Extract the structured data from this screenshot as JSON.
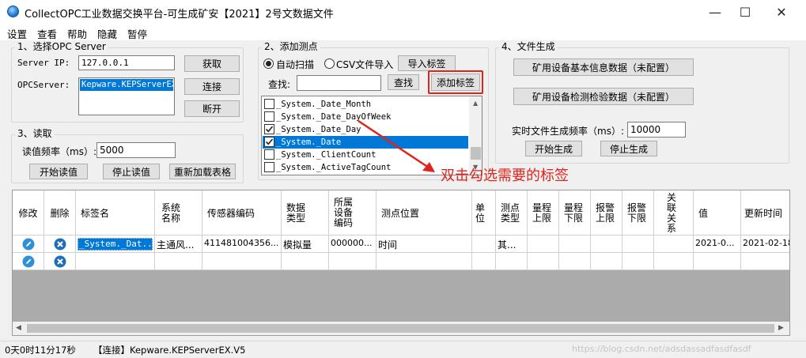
{
  "window": {
    "title": "CollectOPC工业数据交换平台-可生成矿安【2021】2号文数据文件",
    "controls": {
      "minimize": "—",
      "maximize": "☐",
      "close": "✕"
    }
  },
  "menu": {
    "items": [
      "设置",
      "查看",
      "帮助",
      "隐藏",
      "暂停"
    ]
  },
  "opc_select": {
    "title": "1、选择OPC Server",
    "server_ip_label": "Server IP:",
    "server_ip_value": "127.0.0.1",
    "opcserver_label": "OPCServer:",
    "opcserver_value": "Kepware.KEPServerEX",
    "fetch_button": "获取",
    "connect_button": "连接",
    "disconnect_button": "断开"
  },
  "read": {
    "title": "3、读取",
    "freq_label": "读值频率（ms）:",
    "freq_value": "5000",
    "start_button": "开始读值",
    "stop_button": "停止读值",
    "reload_button": "重新加载表格"
  },
  "add_points": {
    "title": "2、添加测点",
    "auto_scan_label": "自动扫描",
    "csv_import_label": "CSV文件导入",
    "import_tags_button": "导入标签",
    "search_label": "查找:",
    "search_value": "",
    "search_button": "查找",
    "add_tag_button": "添加标签",
    "tags": [
      {
        "label": "_System._Date_Month",
        "checked": false,
        "selected": false
      },
      {
        "label": "_System._Date_DayOfWeek",
        "checked": false,
        "selected": false
      },
      {
        "label": "_System._Date_Day",
        "checked": true,
        "selected": false
      },
      {
        "label": "_System._Date",
        "checked": true,
        "selected": true
      },
      {
        "label": "_System._ClientCount",
        "checked": false,
        "selected": false
      },
      {
        "label": "_System._ActiveTagCount",
        "checked": false,
        "selected": false
      }
    ]
  },
  "file_gen": {
    "title": "4、文件生成",
    "basic_info_button": "矿用设备基本信息数据（未配置）",
    "inspection_button": "矿用设备检测检验数据（未配置）",
    "freq_label": "实时文件生成频率（ms）:",
    "freq_value": "10000",
    "start_button": "开始生成",
    "stop_button": "停止生成"
  },
  "annotation": {
    "text": "双击勾选需要的标签",
    "color": "#e0231c"
  },
  "table": {
    "columns": [
      "修改",
      "删除",
      "标签名",
      "系统名称",
      "传感器编码",
      "数据类型",
      "所属设备编码",
      "测点位置",
      "单位",
      "测点类型",
      "量程上限",
      "量程下限",
      "报警上限",
      "报警下限",
      "关联关系",
      "值",
      "更新时间"
    ],
    "rows": [
      {
        "tag": "_System._Dat...",
        "system": "主通风...",
        "sensor": "411481004356...",
        "dtype": "模拟量",
        "device": "000000...",
        "position": "时间",
        "unit": "",
        "ptype": "其...",
        "range_hi": "",
        "range_lo": "",
        "alarm_hi": "",
        "alarm_lo": "",
        "relation": "",
        "value": "2021-0...",
        "time": "2021-02-18"
      },
      {
        "tag": "",
        "system": "",
        "sensor": "",
        "dtype": "",
        "device": "",
        "position": "",
        "unit": "",
        "ptype": "",
        "range_hi": "",
        "range_lo": "",
        "alarm_hi": "",
        "alarm_lo": "",
        "relation": "",
        "value": "",
        "time": ""
      }
    ]
  },
  "status": {
    "uptime": "0天0时11分17秒",
    "connection": "【连接】Kepware.KEPServerEX.V5",
    "watermark": "https://blog.csdn.net/adsdassadfasdfasdf"
  },
  "colors": {
    "selection": "#0078d7",
    "edit_icon": "#2f8fd8",
    "delete_icon": "#1f6fb8",
    "highlight_border": "#e0231c"
  }
}
